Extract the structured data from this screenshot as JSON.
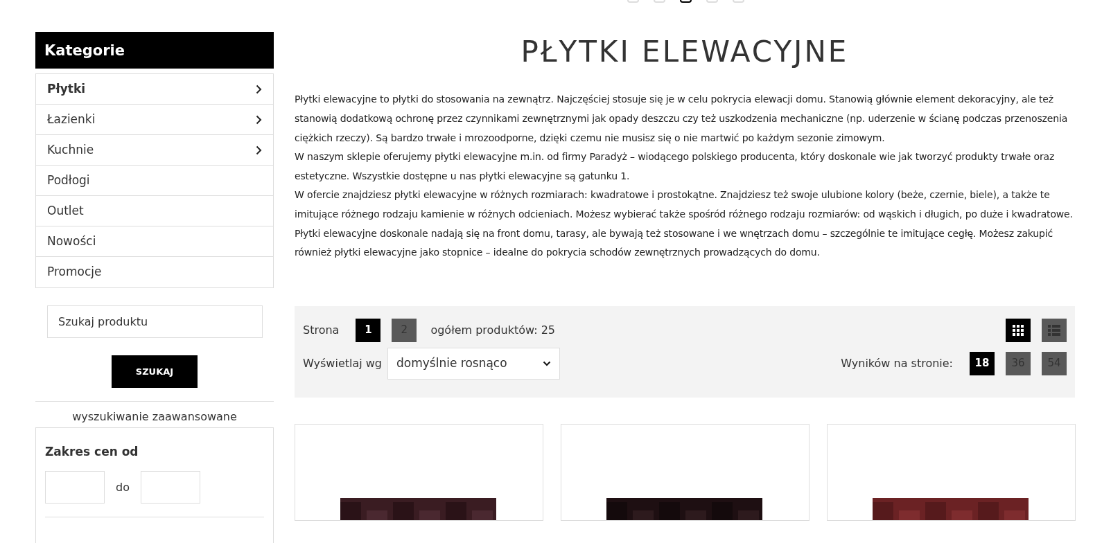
{
  "slider_dots": [
    {
      "selected": false
    },
    {
      "selected": false
    },
    {
      "selected": true
    },
    {
      "selected": false
    },
    {
      "selected": false
    }
  ],
  "sidebar": {
    "title": "Kategorie",
    "categories": [
      {
        "label": "Płytki",
        "selected": true,
        "has_submenu": true
      },
      {
        "label": "Łazienki",
        "selected": false,
        "has_submenu": true
      },
      {
        "label": "Kuchnie",
        "selected": false,
        "has_submenu": true
      },
      {
        "label": "Podłogi",
        "selected": false,
        "has_submenu": false
      },
      {
        "label": "Outlet",
        "selected": false,
        "has_submenu": false
      },
      {
        "label": "Nowości",
        "selected": false,
        "has_submenu": false
      },
      {
        "label": "Promocje",
        "selected": false,
        "has_submenu": false
      }
    ],
    "search": {
      "placeholder": "Szukaj produktu",
      "button": "SZUKAJ"
    },
    "advanced_link": "wyszukiwanie zaawansowane",
    "price_filter": {
      "label": "Zakres cen od",
      "separator": "do"
    }
  },
  "main": {
    "title": "PŁYTKI ELEWACYJNE",
    "paragraphs": [
      "Płytki elewacyjne to płytki do stosowania na zewnątrz. Najczęściej stosuje się je w celu pokrycia elewacji domu. Stanowią głównie element dekoracyjny, ale też stanowią dodatkową ochronę przez czynnikami zewnętrznymi jak opady deszczu czy też uszkodzenia mechaniczne (np. uderzenie w ścianę podczas przenoszenia ciężkich rzeczy). Są bardzo trwałe i mrozoodporne, dzięki czemu nie musisz się o nie martwić po każdym sezonie zimowym.",
      "W naszym sklepie oferujemy płytki elewacyjne m.in. od firmy Paradyż – wiodącego polskiego producenta, który doskonale wie jak tworzyć produkty trwałe oraz estetyczne. Wszystkie dostępne u nas płytki elewacyjne są gatunku 1.",
      "W ofercie znajdziesz płytki elewacyjne w różnych rozmiarach: kwadratowe i prostokątne. Znajdziesz też swoje ulubione kolory (beże, czernie, biele), a także te imitujące różnego rodzaju kamienie w różnych odcieniach. Możesz wybierać także spośród różnego rodzaju rozmiarów: od wąskich i długich, po duże i kwadratowe.",
      "Płytki elewacyjne doskonale nadają się na front domu, tarasy, ale bywają też stosowane i we wnętrzach domu – szczególnie te imitujące cegłę. Możesz zakupić również płytki elewacyjne jako stopnice – idealne do pokrycia schodów zewnętrznych prowadzących do domu."
    ],
    "toolbar": {
      "page_label": "Strona",
      "pages": [
        {
          "label": "1",
          "selected": true
        },
        {
          "label": "2",
          "selected": false
        }
      ],
      "total": "ogółem produktów: 25",
      "view_modes": [
        {
          "kind": "grid",
          "selected": true
        },
        {
          "kind": "list",
          "selected": false
        }
      ],
      "sort_label": "Wyświetlaj wg",
      "sort_value": "domyślnie rosnąco",
      "per_page_label": "Wyników na stronie:",
      "per_page": [
        {
          "label": "18",
          "selected": true
        },
        {
          "label": "36",
          "selected": false
        },
        {
          "label": "54",
          "selected": false
        }
      ]
    },
    "products": [
      {
        "kind": "picture"
      },
      {
        "kind": "picture"
      },
      {
        "kind": "picture"
      }
    ]
  }
}
